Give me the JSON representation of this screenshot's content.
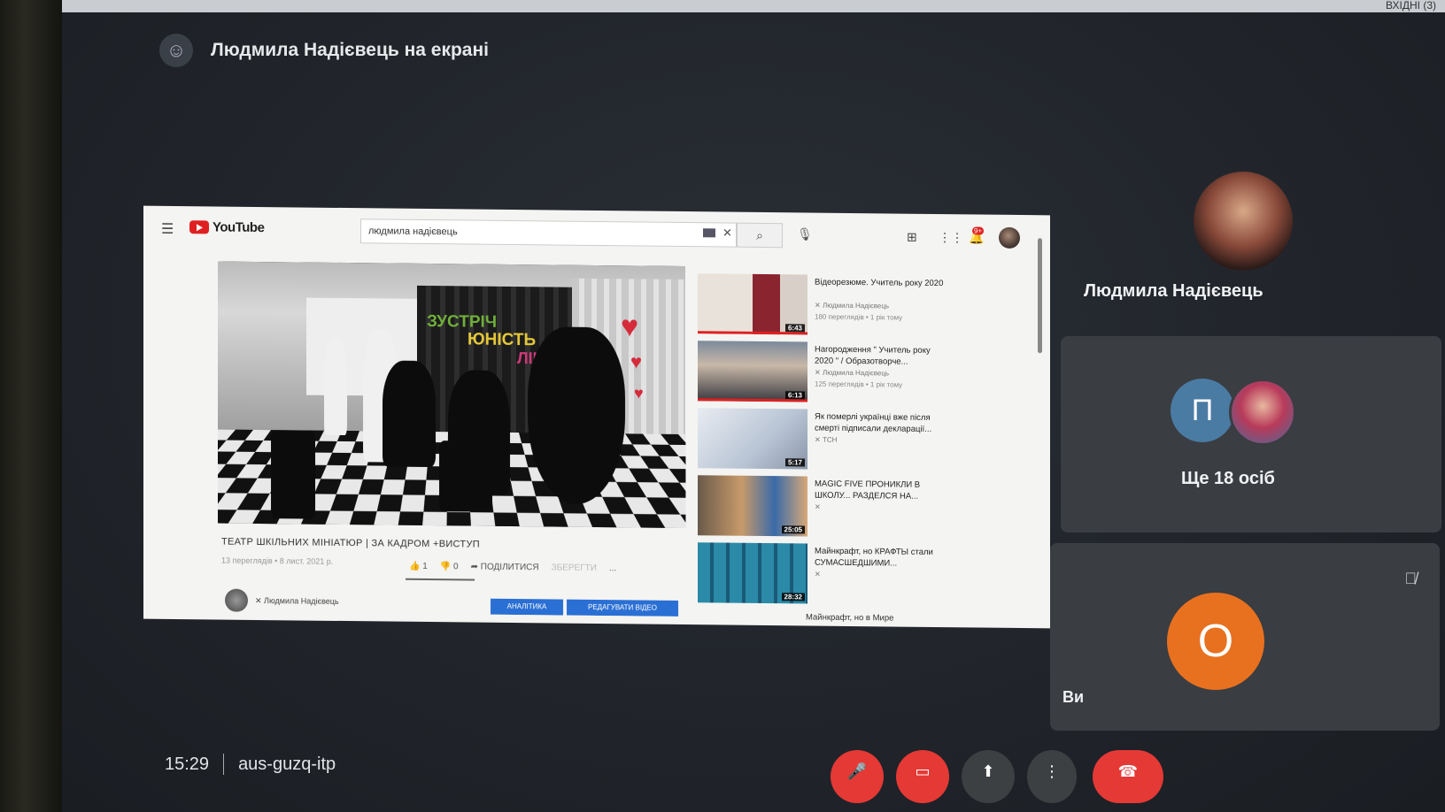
{
  "top_bar": {
    "tab_text": "ВХІДНІ (3)"
  },
  "presenter": {
    "text": "Людмила Надієвець на екрані",
    "icon": "presenter-avatar-icon"
  },
  "youtube": {
    "logo": "YouTube",
    "search_value": "людмила надієвець",
    "notification_count": "9+",
    "video_overlay": {
      "line1": "ЗУСТРІЧ",
      "line2": "ЮНІСТЬ",
      "line3": "ЛІЦЕЮ"
    },
    "video_title": "ТЕАТР ШКІЛЬНИХ МІНІАТЮР | ЗА КАДРОМ +ВИСТУП",
    "video_meta": "13 переглядів • 8 лист. 2021 р.",
    "likes": "1",
    "dislikes": "0",
    "share_label": "ПОДІЛИТИСЯ",
    "save_label": "ЗБЕРЕГТИ",
    "more_label": "...",
    "channel_name": "Людмила Надієвець",
    "btn_analytics": "АНАЛІТИКА",
    "btn_edit": "РЕДАГУВАТИ ВІДЕО",
    "recommendations": [
      {
        "title": "Відеорезюме. Учитель року 2020",
        "channel": "Людмила Надієвець",
        "views": "180 переглядів • 1 рік тому",
        "duration": "6:43"
      },
      {
        "title": "Нагородження \" Учитель року 2020 \" / Образотворче...",
        "channel": "Людмила Надієвець",
        "views": "125 переглядів • 1 рік тому",
        "duration": "6:13"
      },
      {
        "title": "Як померлі українці вже після смерті підписали декларації...",
        "channel": "ТСН",
        "views": "",
        "duration": "5:17"
      },
      {
        "title": "MAGIC FIVE ПРОНИКЛИ В ШКОЛУ... РАЗДЕЛСЯ НА...",
        "channel": "",
        "views": "",
        "duration": "25:05"
      },
      {
        "title": "Майнкрафт, но КРАФТЫ стали СУМАСШЕДШИМИ...",
        "channel": "",
        "views": "",
        "duration": "28:32"
      }
    ],
    "last_partial_title": "Майнкрафт, но в Мире"
  },
  "participants": {
    "main_name": "Людмила Надієвець",
    "others_letter": "П",
    "others_text": "Ще 18 осіб",
    "self_letter": "О",
    "self_label": "Ви"
  },
  "meeting": {
    "time": "15:29",
    "code": "aus-guzq-itp"
  },
  "colors": {
    "accent_orange": "#e8711f",
    "end_call_red": "#e53935",
    "p_avatar_blue": "#4a7ba3"
  }
}
